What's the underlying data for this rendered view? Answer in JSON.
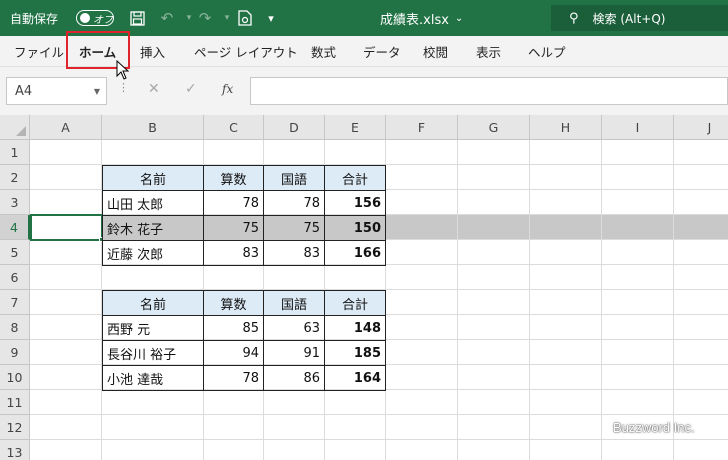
{
  "titlebar": {
    "autosave_label": "自動保存",
    "autosave_state": "オフ",
    "filename": "成績表.xlsx",
    "search_label": "検索 (Alt+Q)",
    "bg_color": "#217346"
  },
  "ribbon": {
    "tabs": [
      "ファイル",
      "ホーム",
      "挿入",
      "ページ レイアウト",
      "数式",
      "データ",
      "校閲",
      "表示",
      "ヘルプ"
    ],
    "active_tab": "ホーム",
    "highlight_color": "#e0242b"
  },
  "formula_bar": {
    "name_box": "A4",
    "fx_label": "fx",
    "formula": ""
  },
  "grid": {
    "columns": [
      "A",
      "B",
      "C",
      "D",
      "E",
      "F",
      "G",
      "H",
      "I",
      "J"
    ],
    "rows": [
      "1",
      "2",
      "3",
      "4",
      "5",
      "6",
      "7",
      "8",
      "9",
      "10",
      "11",
      "12",
      "13"
    ],
    "selected_cell": "A4",
    "selected_row": "4",
    "accent_color": "#217346"
  },
  "table1": {
    "headers": [
      "名前",
      "算数",
      "国語",
      "合計"
    ],
    "rows": [
      [
        "山田 太郎",
        "78",
        "78",
        "156"
      ],
      [
        "鈴木 花子",
        "75",
        "75",
        "150"
      ],
      [
        "近藤 次郎",
        "83",
        "83",
        "166"
      ]
    ]
  },
  "table2": {
    "headers": [
      "名前",
      "算数",
      "国語",
      "合計"
    ],
    "rows": [
      [
        "西野 元",
        "85",
        "63",
        "148"
      ],
      [
        "長谷川 裕子",
        "94",
        "91",
        "185"
      ],
      [
        "小池 達哉",
        "78",
        "86",
        "164"
      ]
    ]
  },
  "header_fill_color": "#ddebf7",
  "watermark": "Buzzword Inc."
}
